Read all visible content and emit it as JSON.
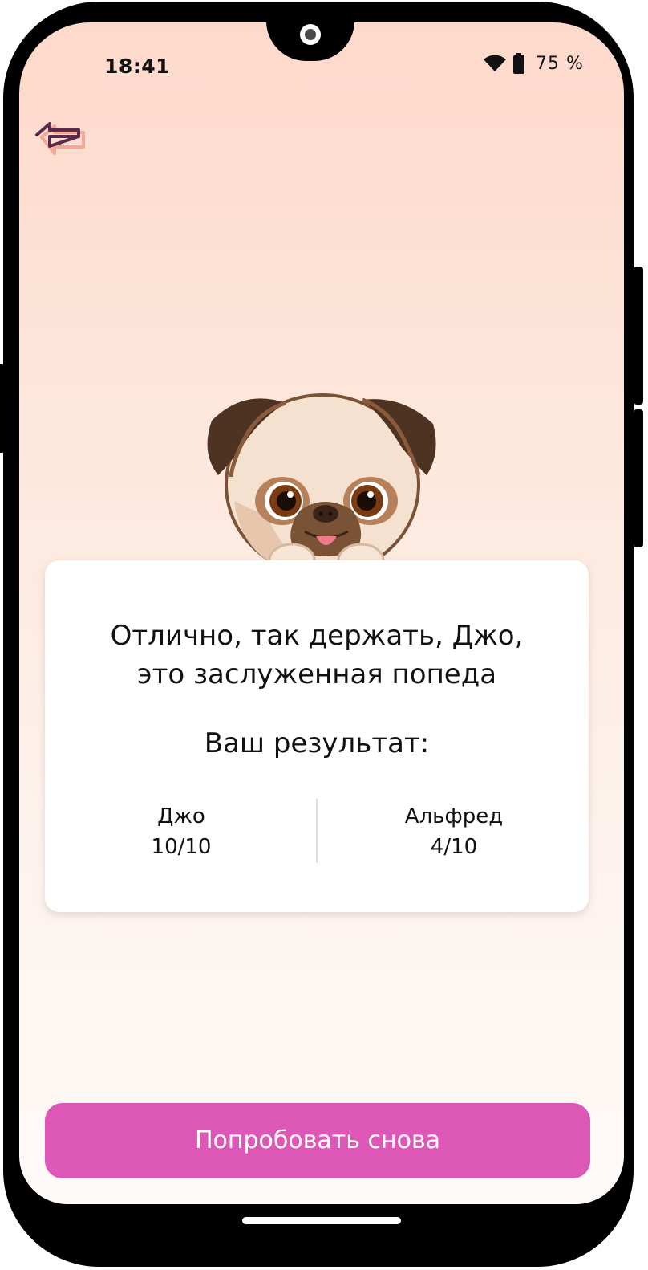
{
  "status_bar": {
    "time": "18:41",
    "battery_text": "75 %",
    "icons": [
      "wifi-icon",
      "battery-icon"
    ]
  },
  "nav": {
    "back_icon": "back-arrow-icon"
  },
  "illustration": {
    "name": "pug-illustration"
  },
  "result_card": {
    "message_line1": "Отлично, так держать, Джо,",
    "message_line2": "это заслуженная попеда",
    "result_title": "Ваш результат:",
    "players": [
      {
        "name": "Джо",
        "score": "10/10"
      },
      {
        "name": "Альфред",
        "score": "4/10"
      }
    ]
  },
  "actions": {
    "retry_label": "Попробовать снова"
  },
  "colors": {
    "accent": "#dd58b6",
    "background_top": "#fdd9cb",
    "background_bottom": "#fefaf8",
    "back_icon": "#5a2a48",
    "back_icon_shadow": "#f4a796"
  }
}
